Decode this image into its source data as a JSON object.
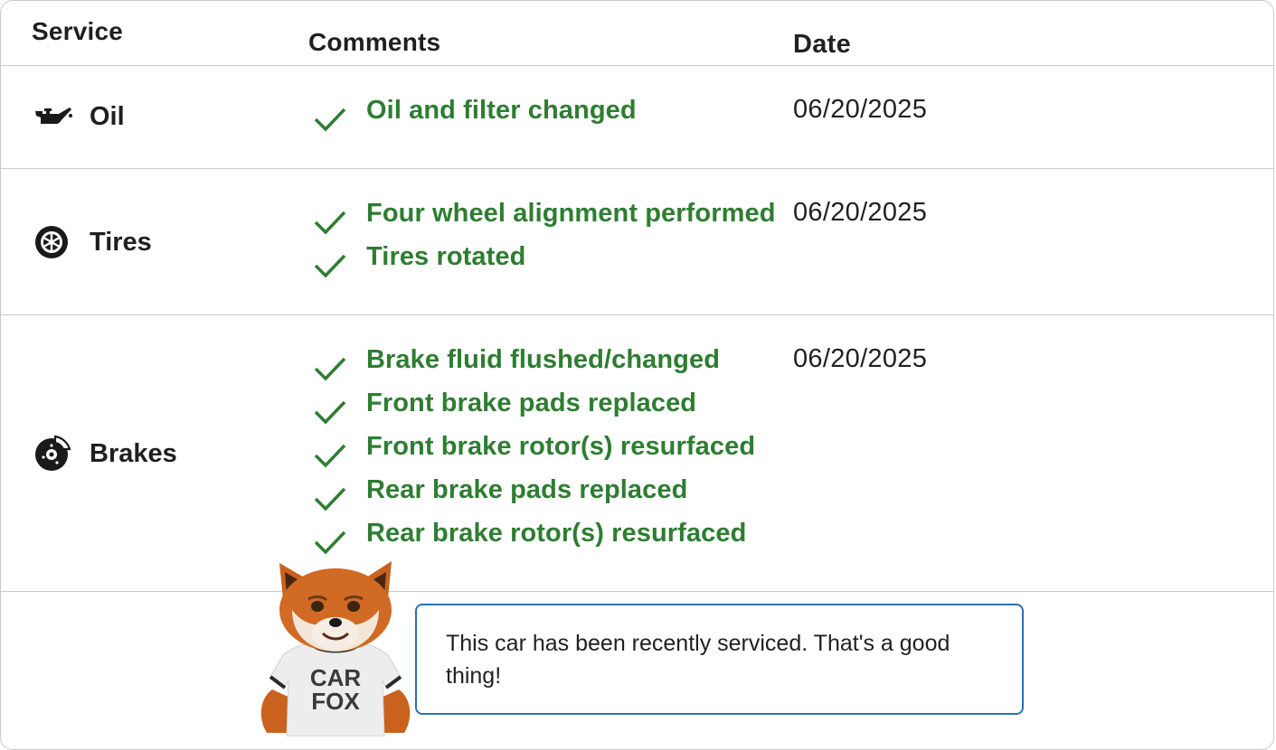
{
  "header": {
    "service": "Service",
    "comments": "Comments",
    "date": "Date"
  },
  "rows": [
    {
      "service": "Oil",
      "icon": "oil-can-icon",
      "comments": [
        "Oil and filter changed"
      ],
      "date": "06/20/2025"
    },
    {
      "service": "Tires",
      "icon": "tire-icon",
      "comments": [
        "Four wheel alignment performed",
        "Tires rotated"
      ],
      "date": "06/20/2025"
    },
    {
      "service": "Brakes",
      "icon": "brake-disc-icon",
      "comments": [
        "Brake fluid flushed/changed",
        "Front brake pads replaced",
        "Front brake rotor(s) resurfaced",
        "Rear brake pads replaced",
        "Rear brake rotor(s) resurfaced"
      ],
      "date": "06/20/2025"
    }
  ],
  "fox": {
    "shirt_line1": "CAR",
    "shirt_line2": "FOX"
  },
  "message": "This car has been recently serviced. That's a good thing!",
  "colors": {
    "comment_green": "#2e7d32",
    "bubble_border": "#2f6db5",
    "divider": "#c9c9c9",
    "text": "#212121"
  }
}
